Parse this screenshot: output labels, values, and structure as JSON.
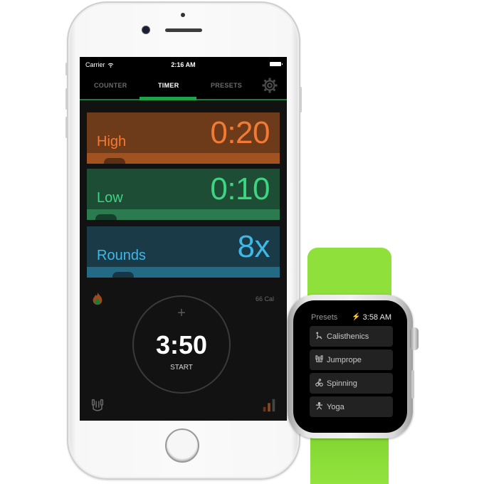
{
  "phone": {
    "statusbar": {
      "carrier": "Carrier",
      "time": "2:16 AM"
    },
    "tabs": [
      {
        "label": "COUNTER",
        "active": false
      },
      {
        "label": "TIMER",
        "active": true
      },
      {
        "label": "PRESETS",
        "active": false
      }
    ],
    "intervals": [
      {
        "label": "High",
        "value": "0:20",
        "color": "#f47a33"
      },
      {
        "label": "Low",
        "value": "0:10",
        "color": "#3fd382"
      },
      {
        "label": "Rounds",
        "value": "8x",
        "color": "#3fb8e6"
      }
    ],
    "calories": "66 Cal",
    "timer": {
      "plus": "+",
      "total": "3:50",
      "action": "START"
    },
    "accent_color": "#1fa34a"
  },
  "watch": {
    "title": "Presets",
    "time": "3:58 AM",
    "presets": [
      {
        "label": "Calisthenics",
        "icon": "calisthenics-icon"
      },
      {
        "label": "Jumprope",
        "icon": "jumprope-icon"
      },
      {
        "label": "Spinning",
        "icon": "spinning-icon"
      },
      {
        "label": "Yoga",
        "icon": "yoga-icon"
      }
    ],
    "band_color": "#8fe03a"
  }
}
